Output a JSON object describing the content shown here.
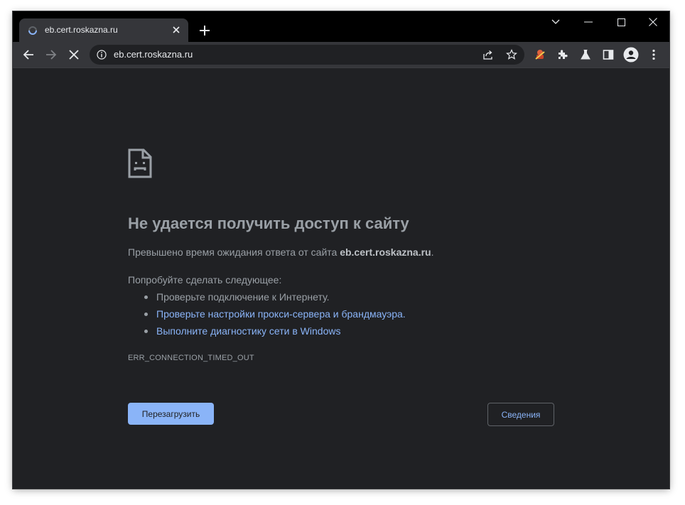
{
  "tab": {
    "title": "eb.cert.roskazna.ru",
    "loading": true
  },
  "omnibox": {
    "url": "eb.cert.roskazna.ru"
  },
  "icons": {
    "back": "back-arrow-icon",
    "forward": "forward-arrow-icon",
    "stop": "stop-loading-icon",
    "info": "site-info-icon",
    "share": "share-icon",
    "bookmark": "bookmark-star-icon",
    "extensions": [
      "extension-icon",
      "puzzle-icon",
      "labs-flask-icon",
      "side-panel-icon",
      "profile-avatar-icon",
      "menu-kebab-icon"
    ],
    "window": [
      "tab-search-chevron-icon",
      "minimize-icon",
      "maximize-icon",
      "close-window-icon"
    ]
  },
  "error": {
    "title": "Не удается получить доступ к сайту",
    "description_prefix": "Превышено время ожидания ответа от сайта ",
    "description_host": "eb.cert.roskazna.ru",
    "description_suffix": ".",
    "try_heading": "Попробуйте сделать следующее:",
    "suggestions": [
      {
        "text": "Проверьте подключение к Интернету.",
        "link": false
      },
      {
        "text": "Проверьте настройки прокси-сервера и брандмауэра.",
        "link": true
      },
      {
        "text": "Выполните диагностику сети в Windows",
        "link": true
      }
    ],
    "code": "ERR_CONNECTION_TIMED_OUT"
  },
  "buttons": {
    "reload": "Перезагрузить",
    "details": "Сведения"
  },
  "colors": {
    "background": "#202124",
    "toolbar": "#35363a",
    "link": "#8ab4f8",
    "text": "#9aa0a6",
    "button": "#8ab4f8"
  }
}
